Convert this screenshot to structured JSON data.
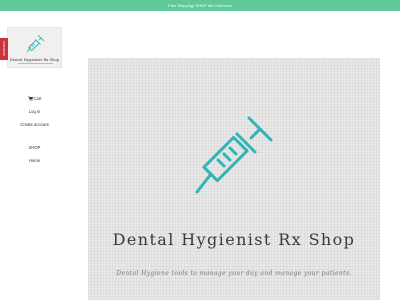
{
  "announcement": {
    "text": "Free Shipping! SHOP the Collection"
  },
  "brand": {
    "logo_text": "Dental Hygienist Rx Shop"
  },
  "reward_tab": {
    "label": "REWARDS"
  },
  "nav": {
    "cart_label": "Cart",
    "login_label": "Log in",
    "create_account_label": "Create account",
    "shop_label": "SHOP",
    "home_label": "Home"
  },
  "hero": {
    "title": "Dental Hygienist Rx Shop",
    "subtitle": "Dental Hygiene tools to manage your day and manage your patients."
  },
  "colors": {
    "announcement_bg": "#5fc99a",
    "accent_teal": "#2fb5b5",
    "reward_red": "#c9333b",
    "hero_bg": "#e8e8e8"
  },
  "icons": {
    "logo": "syringe-icon",
    "cart": "cart-icon",
    "hero": "syringe-icon"
  }
}
